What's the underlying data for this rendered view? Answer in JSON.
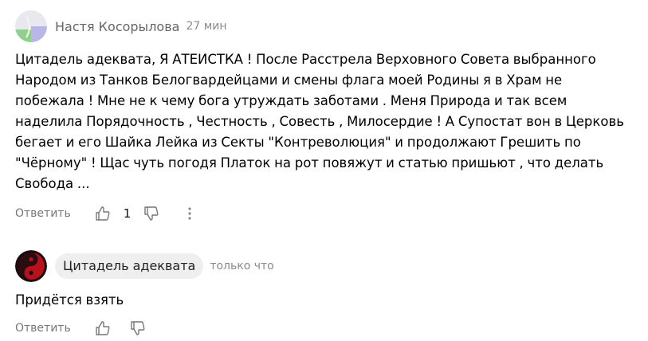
{
  "comments": [
    {
      "author": "Настя Косорылова",
      "time": "27 мин",
      "text": "Цитадель адеквата, Я АТЕИСТКА ! После Расстрела Верховного Совета выбранного Народом из Танков Белогвардейцами и смены флага моей Родины я в Храм не побежала ! Мне не к чему бога утруждать заботами . Меня Природа и так всем наделила Порядочность , Честность , Совесть , Милосердие ! А Супостат вон в Церковь бегает и его Шайка Лейка из Секты \"Контреволюция\" и продолжают Грешить по \"Чёрному\" ! Щас чуть погодя Платок на рот повяжут и статью пришьют , что делать Свобода ...",
      "reply_label": "Ответить",
      "likes": "1",
      "icons": [
        "like-icon",
        "dislike-icon",
        "more-icon"
      ]
    },
    {
      "author": "Цитадель адеквата",
      "time": "только что",
      "text": "Придётся взять",
      "reply_label": "Ответить",
      "icons": [
        "like-icon",
        "dislike-icon"
      ]
    }
  ],
  "colors": {
    "avatar1_bg": "#e7e9ee",
    "avatar1_green": "#8fd18b",
    "avatar1_purple": "#b9b6ea",
    "avatar2_red": "#b5121b",
    "muted_text": "#777777"
  }
}
